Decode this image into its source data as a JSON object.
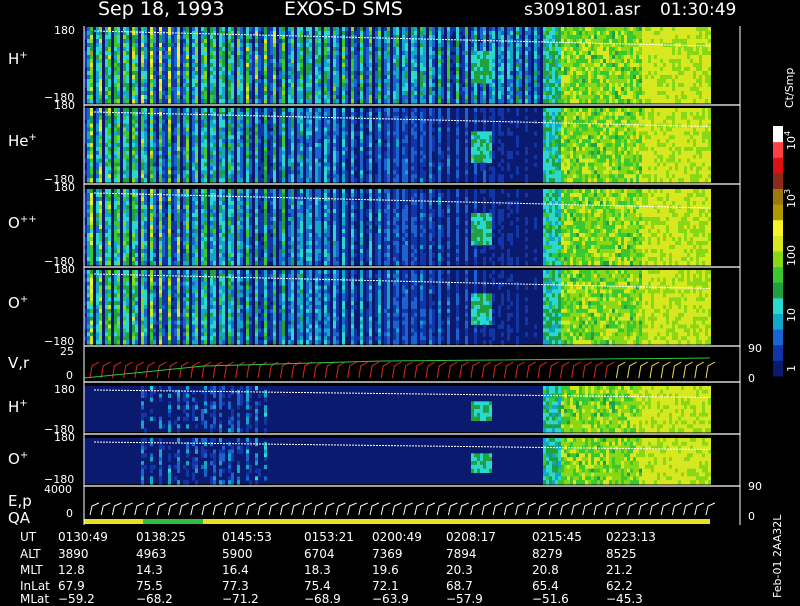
{
  "header": {
    "date": "Sep 18, 1993",
    "instrument": "EXOS-D SMS",
    "file": "s3091801.asr",
    "time": "01:30:49"
  },
  "colorbar": {
    "unit_label": "Ct/Smp",
    "tick_labels": [
      "1",
      "10",
      "100",
      "10",
      "10"
    ],
    "tick_exponents": [
      "",
      "",
      "",
      "3",
      "4"
    ],
    "stops": [
      "#0a1a6e",
      "#1236a8",
      "#1a63d0",
      "#12a6c8",
      "#2ad8d0",
      "#22a040",
      "#3ac830",
      "#88d818",
      "#d8e820",
      "#f4f428",
      "#b09a00",
      "#9a7a10",
      "#8a2a18",
      "#e01010",
      "#ff4040",
      "#ffffff"
    ]
  },
  "chart_data": {
    "type": "heatmap",
    "panels": [
      {
        "label_base": "H",
        "label_sup": "+",
        "ytop": "180",
        "ybot": "−180",
        "ylim": [
          -180,
          180
        ]
      },
      {
        "label_base": "He",
        "label_sup": "+",
        "ytop": "180",
        "ybot": "−180",
        "ylim": [
          -180,
          180
        ]
      },
      {
        "label_base": "O",
        "label_sup": "++",
        "ytop": "180",
        "ybot": "−180",
        "ylim": [
          -180,
          180
        ]
      },
      {
        "label_base": "O",
        "label_sup": "+",
        "ytop": "180",
        "ybot": "−180",
        "ylim": [
          -180,
          180
        ]
      },
      {
        "label_base": "H",
        "label_sup": "+",
        "ytop": "180",
        "ybot": "−180",
        "ylim": [
          -180,
          180
        ]
      },
      {
        "label_base": "O",
        "label_sup": "+",
        "ytop": "180",
        "ybot": "−180",
        "ylim": [
          -180,
          180
        ]
      }
    ],
    "vr_panel": {
      "label": "V,r",
      "left_ticks": [
        "25",
        "0"
      ],
      "right_ticks": [
        "90",
        "0"
      ],
      "ylim": [
        0,
        25
      ]
    },
    "ep_panel": {
      "label_top": "E,p",
      "label_bottom": "QA",
      "left_ticks": [
        "4000",
        "0"
      ],
      "right_ticks": [
        "90",
        "0"
      ],
      "ylim": [
        0,
        4000
      ]
    },
    "time_axis": {
      "row_labels": [
        "UT",
        "ALT",
        "MLT",
        "InLat",
        "MLat"
      ],
      "ticks": [
        {
          "UT": "0130:49",
          "ALT": "3890",
          "MLT": "12.8",
          "InLat": "67.9",
          "MLat": "−59.2"
        },
        {
          "UT": "0138:25",
          "ALT": "4963",
          "MLT": "14.3",
          "InLat": "75.5",
          "MLat": "−68.2"
        },
        {
          "UT": "0145:53",
          "ALT": "5900",
          "MLT": "16.4",
          "InLat": "77.3",
          "MLat": "−71.2"
        },
        {
          "UT": "0153:21",
          "ALT": "6704",
          "MLT": "18.3",
          "InLat": "75.4",
          "MLat": "−68.9"
        },
        {
          "UT": "0200:49",
          "ALT": "7369",
          "MLT": "19.6",
          "InLat": "72.1",
          "MLat": "−63.9"
        },
        {
          "UT": "0208:17",
          "ALT": "7894",
          "MLT": "20.3",
          "InLat": "68.7",
          "MLat": "−57.9"
        },
        {
          "UT": "0215:45",
          "ALT": "8279",
          "MLT": "20.8",
          "InLat": "65.4",
          "MLat": "−51.6"
        },
        {
          "UT": "0223:13",
          "ALT": "8525",
          "MLT": "21.2",
          "InLat": "62.2",
          "MLat": "−45.3"
        }
      ]
    },
    "qa_bar_colors": [
      "#e8e020",
      "#30c040"
    ]
  },
  "footer_note": "Feb-01 2AA32L"
}
